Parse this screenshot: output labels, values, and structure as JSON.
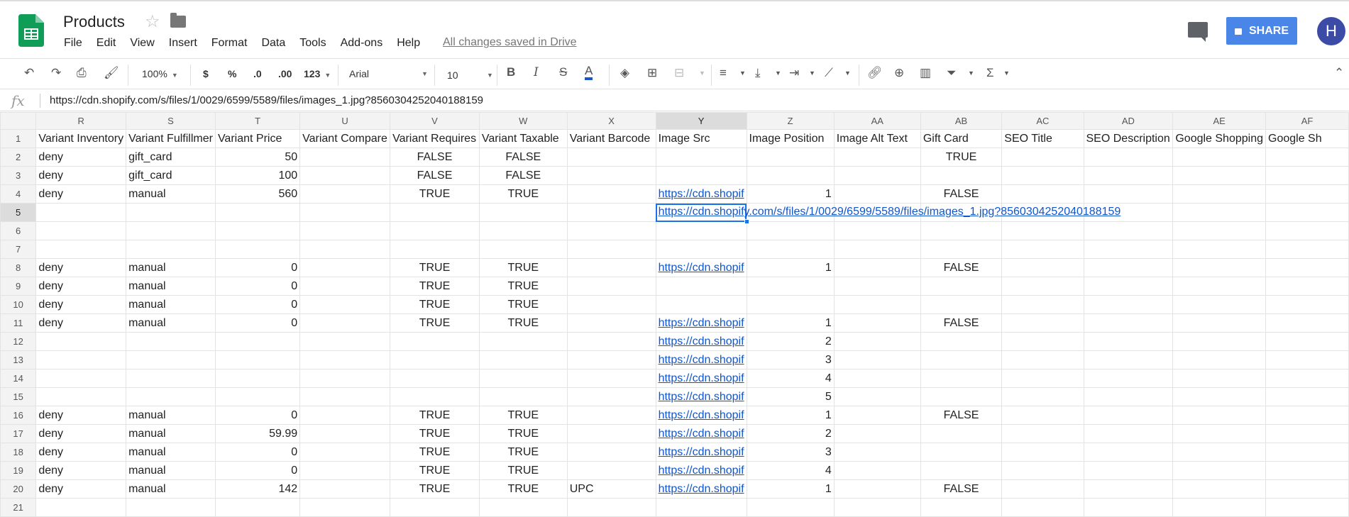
{
  "app": {
    "title": "Products",
    "menus": [
      "File",
      "Edit",
      "View",
      "Insert",
      "Format",
      "Data",
      "Tools",
      "Add-ons",
      "Help"
    ],
    "saved_status": "All changes saved in Drive",
    "share_label": "SHARE",
    "avatar_letter": "H"
  },
  "toolbar": {
    "zoom": "100%",
    "currency": "$",
    "percent": "%",
    "dec_less": ".0",
    "dec_more": ".00",
    "more_formats": "123",
    "font": "Arial",
    "font_size": "10",
    "bold": "B",
    "italic": "I",
    "strike": "S",
    "text_color": "A",
    "sigma": "Σ"
  },
  "formula_bar": {
    "fx": "fx",
    "value": "https://cdn.shopify.com/s/files/1/0029/6599/5589/files/images_1.jpg?8560304252040188159"
  },
  "grid": {
    "columns": [
      "R",
      "S",
      "T",
      "U",
      "V",
      "W",
      "X",
      "Y",
      "Z",
      "AA",
      "AB",
      "AC",
      "AD",
      "AE",
      "AF"
    ],
    "selected_column": "Y",
    "selected_row": "5",
    "active_cell_text": "https://cdn.shopify.com/s/files/1/0029/6599/5589/files/images_1.jpg?8560304252040188159",
    "rows": [
      {
        "n": "1",
        "cells": [
          "Variant Inventory",
          "Variant Fulfillmer",
          "Variant Price",
          "Variant Compare",
          "Variant Requires",
          "Variant Taxable",
          "Variant Barcode",
          "Image Src",
          "Image Position",
          "Image Alt Text",
          "Gift Card",
          "SEO Title",
          "SEO Description",
          "Google Shopping",
          "Google Sh"
        ]
      },
      {
        "n": "2",
        "cells": [
          "deny",
          "gift_card",
          "50",
          "",
          "FALSE",
          "FALSE",
          "",
          "",
          "",
          "",
          "TRUE",
          "",
          "",
          "",
          ""
        ]
      },
      {
        "n": "3",
        "cells": [
          "deny",
          "gift_card",
          "100",
          "",
          "FALSE",
          "FALSE",
          "",
          "",
          "",
          "",
          "",
          "",
          "",
          "",
          ""
        ]
      },
      {
        "n": "4",
        "cells": [
          "deny",
          "manual",
          "560",
          "",
          "TRUE",
          "TRUE",
          "",
          "https://cdn.shopif",
          "1",
          "",
          "FALSE",
          "",
          "",
          "",
          ""
        ]
      },
      {
        "n": "5",
        "cells": [
          "",
          "",
          "",
          "",
          "",
          "",
          "",
          "",
          "",
          "",
          "",
          "",
          "",
          "",
          ""
        ]
      },
      {
        "n": "6",
        "cells": [
          "",
          "",
          "",
          "",
          "",
          "",
          "",
          "",
          "",
          "",
          "",
          "",
          "",
          "",
          ""
        ]
      },
      {
        "n": "7",
        "cells": [
          "",
          "",
          "",
          "",
          "",
          "",
          "",
          "",
          "",
          "",
          "",
          "",
          "",
          "",
          ""
        ]
      },
      {
        "n": "8",
        "cells": [
          "deny",
          "manual",
          "0",
          "",
          "TRUE",
          "TRUE",
          "",
          "https://cdn.shopif",
          "1",
          "",
          "FALSE",
          "",
          "",
          "",
          ""
        ]
      },
      {
        "n": "9",
        "cells": [
          "deny",
          "manual",
          "0",
          "",
          "TRUE",
          "TRUE",
          "",
          "",
          "",
          "",
          "",
          "",
          "",
          "",
          ""
        ]
      },
      {
        "n": "10",
        "cells": [
          "deny",
          "manual",
          "0",
          "",
          "TRUE",
          "TRUE",
          "",
          "",
          "",
          "",
          "",
          "",
          "",
          "",
          ""
        ]
      },
      {
        "n": "11",
        "cells": [
          "deny",
          "manual",
          "0",
          "",
          "TRUE",
          "TRUE",
          "",
          "https://cdn.shopif",
          "1",
          "",
          "FALSE",
          "",
          "",
          "",
          ""
        ]
      },
      {
        "n": "12",
        "cells": [
          "",
          "",
          "",
          "",
          "",
          "",
          "",
          "https://cdn.shopif",
          "2",
          "",
          "",
          "",
          "",
          "",
          ""
        ]
      },
      {
        "n": "13",
        "cells": [
          "",
          "",
          "",
          "",
          "",
          "",
          "",
          "https://cdn.shopif",
          "3",
          "",
          "",
          "",
          "",
          "",
          ""
        ]
      },
      {
        "n": "14",
        "cells": [
          "",
          "",
          "",
          "",
          "",
          "",
          "",
          "https://cdn.shopif",
          "4",
          "",
          "",
          "",
          "",
          "",
          ""
        ]
      },
      {
        "n": "15",
        "cells": [
          "",
          "",
          "",
          "",
          "",
          "",
          "",
          "https://cdn.shopif",
          "5",
          "",
          "",
          "",
          "",
          "",
          ""
        ]
      },
      {
        "n": "16",
        "cells": [
          "deny",
          "manual",
          "0",
          "",
          "TRUE",
          "TRUE",
          "",
          "https://cdn.shopif",
          "1",
          "",
          "FALSE",
          "",
          "",
          "",
          ""
        ]
      },
      {
        "n": "17",
        "cells": [
          "deny",
          "manual",
          "59.99",
          "",
          "TRUE",
          "TRUE",
          "",
          "https://cdn.shopif",
          "2",
          "",
          "",
          "",
          "",
          "",
          ""
        ]
      },
      {
        "n": "18",
        "cells": [
          "deny",
          "manual",
          "0",
          "",
          "TRUE",
          "TRUE",
          "",
          "https://cdn.shopif",
          "3",
          "",
          "",
          "",
          "",
          "",
          ""
        ]
      },
      {
        "n": "19",
        "cells": [
          "deny",
          "manual",
          "0",
          "",
          "TRUE",
          "TRUE",
          "",
          "https://cdn.shopif",
          "4",
          "",
          "",
          "",
          "",
          "",
          ""
        ]
      },
      {
        "n": "20",
        "cells": [
          "deny",
          "manual",
          "142",
          "",
          "TRUE",
          "TRUE",
          "UPC",
          "https://cdn.shopif",
          "1",
          "",
          "FALSE",
          "",
          "",
          "",
          ""
        ]
      },
      {
        "n": "21",
        "cells": [
          "",
          "",
          "",
          "",
          "",
          "",
          "",
          "",
          "",
          "",
          "",
          "",
          "",
          "",
          ""
        ]
      }
    ]
  }
}
